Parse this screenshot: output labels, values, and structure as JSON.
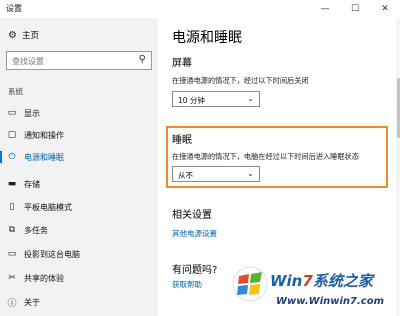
{
  "window": {
    "title": "设置",
    "minimize": "—",
    "maximize": "☐",
    "close": "✕"
  },
  "sidebar": {
    "home": {
      "icon": "gear-icon",
      "label": "主页"
    },
    "search": {
      "placeholder": "查找设置"
    },
    "section_label": "系统",
    "items": [
      {
        "icon": "display-icon",
        "label": "显示",
        "active": false
      },
      {
        "icon": "notification-icon",
        "label": "通知和操作",
        "active": false
      },
      {
        "icon": "power-icon",
        "label": "电源和睡眠",
        "active": true
      },
      {
        "icon": "storage-icon",
        "label": "存储",
        "active": false
      },
      {
        "icon": "tablet-icon",
        "label": "平板电脑模式",
        "active": false
      },
      {
        "icon": "multitask-icon",
        "label": "多任务",
        "active": false
      },
      {
        "icon": "project-icon",
        "label": "投影到这台电脑",
        "active": false
      },
      {
        "icon": "share-icon",
        "label": "共享的体验",
        "active": false
      },
      {
        "icon": "info-icon",
        "label": "关于",
        "active": false
      }
    ]
  },
  "main": {
    "title": "电源和睡眠",
    "screen": {
      "heading": "屏幕",
      "desc": "在接通电源的情况下，经过以下时间后关闭",
      "value": "10 分钟"
    },
    "sleep": {
      "heading": "睡眠",
      "desc": "在接通电源的情况下，电脑在经过以下时间后进入睡眠状态",
      "value": "从不"
    },
    "related": {
      "heading": "相关设置",
      "link": "其他电源设置"
    },
    "help": {
      "heading": "有问题吗?",
      "link": "获取帮助"
    }
  },
  "watermark": {
    "brand_prefix": "Win",
    "brand_num": "7",
    "brand_suffix": "系统之家",
    "url": "Www.Winwin7.com"
  },
  "colors": {
    "accent": "#0078d7",
    "highlight_border": "#f08a24",
    "link": "#0063b1"
  }
}
